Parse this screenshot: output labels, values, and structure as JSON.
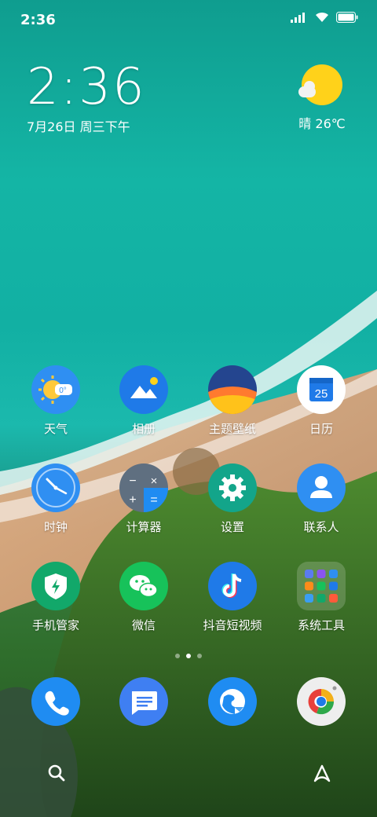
{
  "status_bar": {
    "time": "2:36",
    "icons": [
      "signal-icon",
      "wifi-icon",
      "battery-icon"
    ]
  },
  "clock_widget": {
    "time": "2:36",
    "date": "7月26日 周三下午"
  },
  "weather_widget": {
    "condition": "晴",
    "temperature": "26℃",
    "icon": "sunny-icon"
  },
  "apps": [
    {
      "label": "天气",
      "icon": "weather-icon"
    },
    {
      "label": "相册",
      "icon": "gallery-icon"
    },
    {
      "label": "主题壁纸",
      "icon": "themes-icon"
    },
    {
      "label": "日历",
      "icon": "calendar-icon",
      "badge": "25"
    },
    {
      "label": "时钟",
      "icon": "clock-icon"
    },
    {
      "label": "计算器",
      "icon": "calculator-icon"
    },
    {
      "label": "设置",
      "icon": "settings-gear-icon"
    },
    {
      "label": "联系人",
      "icon": "contacts-icon"
    },
    {
      "label": "手机管家",
      "icon": "security-shield-icon"
    },
    {
      "label": "微信",
      "icon": "wechat-icon"
    },
    {
      "label": "抖音短视频",
      "icon": "tiktok-icon"
    },
    {
      "label": "系统工具",
      "icon": "folder-icon"
    }
  ],
  "page_indicator": {
    "pages": 3,
    "active": 1
  },
  "dock": [
    {
      "icon": "phone-icon"
    },
    {
      "icon": "messages-icon"
    },
    {
      "icon": "browser-icon"
    },
    {
      "icon": "camera-icon"
    }
  ],
  "bottom_bar": {
    "left_icon": "search-icon",
    "right_icon": "assistant-icon"
  },
  "colors": {
    "sea": "#14b5a5",
    "sun": "#ffd21a",
    "blue_icon": "#2f8ff2",
    "green_icon": "#12a86a",
    "wechat_green": "#17c25a"
  }
}
